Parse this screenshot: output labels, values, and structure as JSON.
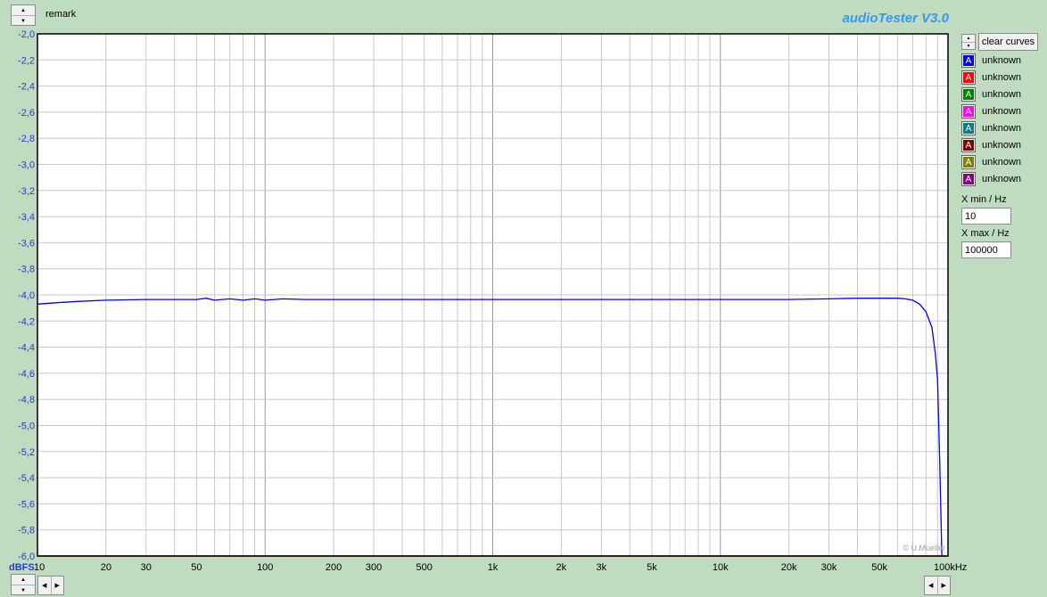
{
  "header": {
    "remark": "remark",
    "brand": "audioTester  V3.0"
  },
  "buttons": {
    "clear_curves": "clear curves"
  },
  "legend": [
    {
      "label": "unknown",
      "color": "#0000ff",
      "glyph": "A"
    },
    {
      "label": "unknown",
      "color": "#ff0000",
      "glyph": "A"
    },
    {
      "label": "unknown",
      "color": "#008000",
      "glyph": "A"
    },
    {
      "label": "unknown",
      "color": "#ff00ff",
      "glyph": "A"
    },
    {
      "label": "unknown",
      "color": "#008080",
      "glyph": "A"
    },
    {
      "label": "unknown",
      "color": "#800000",
      "glyph": "A"
    },
    {
      "label": "unknown",
      "color": "#808000",
      "glyph": "A"
    },
    {
      "label": "unknown",
      "color": "#800080",
      "glyph": "A"
    }
  ],
  "x_range": {
    "min_label": "X min / Hz",
    "min_value": "10",
    "max_label": "X max / Hz",
    "max_value": "100000"
  },
  "chart_data": {
    "type": "line",
    "ylabel": "dBFS",
    "xunit": "Hz",
    "xscale": "log",
    "xlim": [
      10,
      100000
    ],
    "ylim": [
      -6.0,
      -2.0
    ],
    "yticks": [
      -2.0,
      -2.2,
      -2.4,
      -2.6,
      -2.8,
      -3.0,
      -3.2,
      -3.4,
      -3.6,
      -3.8,
      -4.0,
      -4.2,
      -4.4,
      -4.6,
      -4.8,
      -5.0,
      -5.2,
      -5.4,
      -5.6,
      -5.8,
      -6.0
    ],
    "ytick_labels": [
      "-2,0",
      "-2,2",
      "-2,4",
      "-2,6",
      "-2,8",
      "-3,0",
      "-3,2",
      "-3,4",
      "-3,6",
      "-3,8",
      "-4,0",
      "-4,2",
      "-4,4",
      "-4,6",
      "-4,8",
      "-5,0",
      "-5,2",
      "-5,4",
      "-5,6",
      "-5,8",
      "-6,0"
    ],
    "xticks": [
      10,
      20,
      30,
      50,
      100,
      200,
      300,
      500,
      1000,
      2000,
      3000,
      5000,
      10000,
      20000,
      30000,
      50000,
      100000
    ],
    "xtick_labels": [
      "10",
      "20",
      "30",
      "50",
      "100",
      "200",
      "300",
      "500",
      "1k",
      "2k",
      "3k",
      "5k",
      "10k",
      "20k",
      "30k",
      "50k",
      "100kHz"
    ],
    "grid": true,
    "watermark": "© U.Mueller",
    "series": [
      {
        "color": "#0000ff",
        "x": [
          10,
          12,
          15,
          20,
          30,
          40,
          50,
          55,
          60,
          70,
          80,
          90,
          100,
          120,
          150,
          200,
          300,
          500,
          1000,
          2000,
          5000,
          10000,
          20000,
          30000,
          40000,
          50000,
          60000,
          65000,
          70000,
          75000,
          80000,
          85000,
          88000,
          90000,
          92000,
          94000
        ],
        "y": [
          -4.07,
          -4.06,
          -4.05,
          -4.04,
          -4.035,
          -4.035,
          -4.035,
          -4.025,
          -4.04,
          -4.03,
          -4.04,
          -4.03,
          -4.04,
          -4.03,
          -4.035,
          -4.035,
          -4.035,
          -4.035,
          -4.035,
          -4.035,
          -4.035,
          -4.035,
          -4.035,
          -4.03,
          -4.025,
          -4.025,
          -4.025,
          -4.03,
          -4.04,
          -4.07,
          -4.13,
          -4.25,
          -4.45,
          -4.65,
          -5.3,
          -6.0
        ]
      },
      {
        "color": "#ff0000",
        "x": [
          10,
          100000
        ],
        "y": [
          -6.0,
          -6.0
        ]
      }
    ]
  }
}
